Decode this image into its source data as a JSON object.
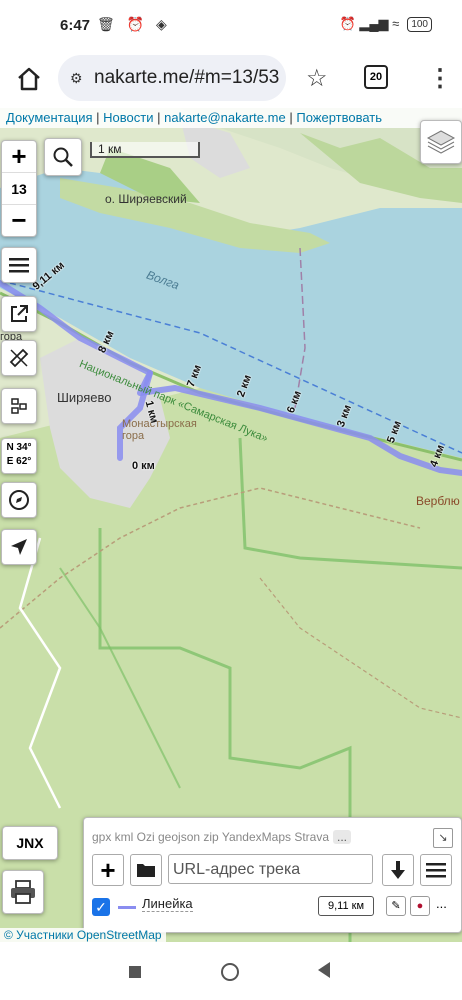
{
  "status_bar": {
    "time": "6:47",
    "left_icons": "🗑 ⏰ ◈",
    "right_icons": "⏰ ▂▄▆ ≈",
    "battery": "100"
  },
  "browser": {
    "url": "nakarte.me/#m=13/53",
    "tab_count": "20"
  },
  "attribution_top": {
    "links": [
      "Документация",
      "Новости",
      "nakarte@nakarte.me",
      "Пожертвовать"
    ],
    "separator": "|"
  },
  "map_controls": {
    "zoom_in": "+",
    "zoom_level": "13",
    "zoom_out": "−",
    "scale_label": "1 км",
    "coords_lat": "N 34°",
    "coords_lon": "E 62°"
  },
  "map_labels": {
    "island": "о. Ширяевский",
    "river": "Волга",
    "park": "Национальный парк «Самарская Лука»",
    "village": "Ширяево",
    "hill": "Монастырская гора",
    "edge_label": "гора",
    "verblyud": "Верблю"
  },
  "distance_markers": [
    "0 км",
    "1 км",
    "2 км",
    "3 км",
    "4 км",
    "5 км",
    "6 км",
    "7 км",
    "8 км",
    "9,11 км"
  ],
  "jnx_label": "JNX",
  "track_panel": {
    "formats": "gpx kml Ozi geojson zip YandexMaps Strava",
    "more": "...",
    "url_placeholder": "URL-адрес трека",
    "track_name": "Линейка",
    "track_length": "9,11 км",
    "track_color": "#8a8df0",
    "more_actions": "..."
  },
  "attribution_bottom": "© Участники OpenStreetMap",
  "colors": {
    "water": "#aad3df",
    "forest": "#c8dfa8",
    "track": "#8a8df0",
    "link": "#0078a8"
  }
}
